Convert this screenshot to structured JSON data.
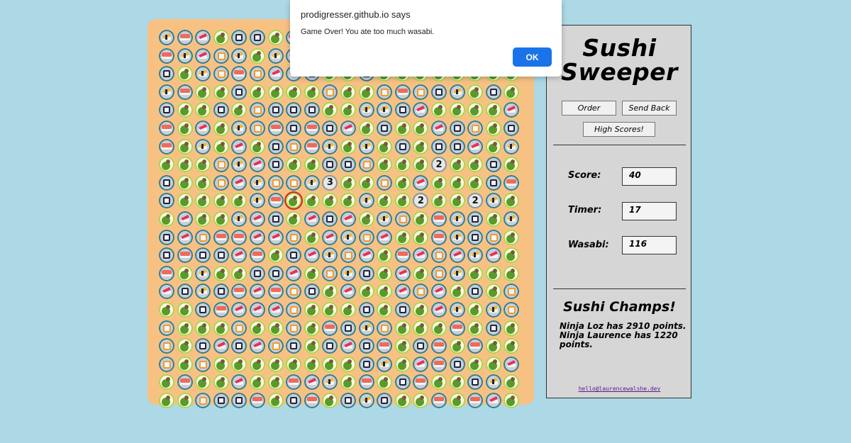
{
  "dialog": {
    "title": "prodigresser.github.io says",
    "message": "Game Over! You ate too much wasabi.",
    "ok_label": "OK"
  },
  "panel": {
    "title_line1": "Sushi",
    "title_line2": "Sweeper",
    "buttons": {
      "order": "Order",
      "send_back": "Send Back",
      "high_scores": "High Scores!"
    },
    "stats": {
      "score_label": "Score:",
      "score": "40",
      "timer_label": "Timer:",
      "timer": "17",
      "wasabi_label": "Wasabi:",
      "wasabi": "116"
    },
    "champs_title": "Sushi Champs!",
    "champs": [
      "Ninja Loz has 2910 points.",
      "Ninja Laurence has 1220 points."
    ],
    "email": "hello@laurencewalshe.dev"
  },
  "board": {
    "rows": [
      "ESTWMMWSETEM",
      "SETOEWETSOWE",
      "MWEOSOTTCWWM",
      "ESWWMWWWWOWWOSOMEWMWW",
      "MWWMWOMMMWWEEMTWWWWTW",
      "SWTWEOSMSMTWMWWTMOWMS",
      "SWEWTWMOSEWEWMWMMTWEM",
      "WWWOETMWWMMOWWW2WWMWT",
      "MWWOTEOOE3WWOWTWWWMSW",
      "MWWWWESXWWWEWW2WW2EW",
      "WTWWETMWTMTWEOWSEMWE",
      "MTOSSTTOWTEOTWWSEMOWT",
      "MSMMTSWMTEOTWSTOTETWM",
      "SWEWWMMTWOEMWTWOEWWW",
      "TMEMSTSOMWTWWTOTWMWOE",
      "WWMSTTTOWWWMWMWTEWEOT",
      "OWWWOWWOWSMEOWWWSWMWE",
      "OWMTMTOMWMTMSWMSWSWW",
      "OWOWWWWWWWWMEWTSMWWTW",
      "WSWWTWWSTEWSWMSWWMEWT",
      "WWOMMSWMSWMEMWWSWSTWWW"
    ],
    "numbers": {
      "3": "3",
      "2": "2"
    },
    "legend": {
      "W": "wasabi-tile",
      "M": "maki-tile",
      "S": "salmon-nigiri-tile",
      "T": "tuna-nigiri-tile",
      "E": "tamago-tile",
      "O": "onigiri-tile",
      "C": "maki-tile",
      "X": "wasabi-lost-tile"
    },
    "colors": {
      "board_bg": "#f7c183",
      "wasabi_ring": "#a6d84a",
      "sushi_ring": "#2e7d8c"
    }
  }
}
